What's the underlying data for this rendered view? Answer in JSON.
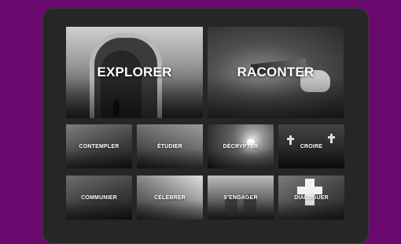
{
  "tiles": {
    "explorer": "EXPLORER",
    "raconter": "RACONTER",
    "contempler": "CONTEMPLER",
    "etudier": "ÉTUDIER",
    "decrypter": "DÉCRYPTER",
    "croire": "CROIRE",
    "communier": "COMMUNIER",
    "celebrer": "CÉLÉBRER",
    "sengager": "S'ENGAGER",
    "dialoguer": "DIALOGUER"
  },
  "colors": {
    "background": "#6a0a6e",
    "device": "#262626",
    "label": "#ffffff"
  }
}
